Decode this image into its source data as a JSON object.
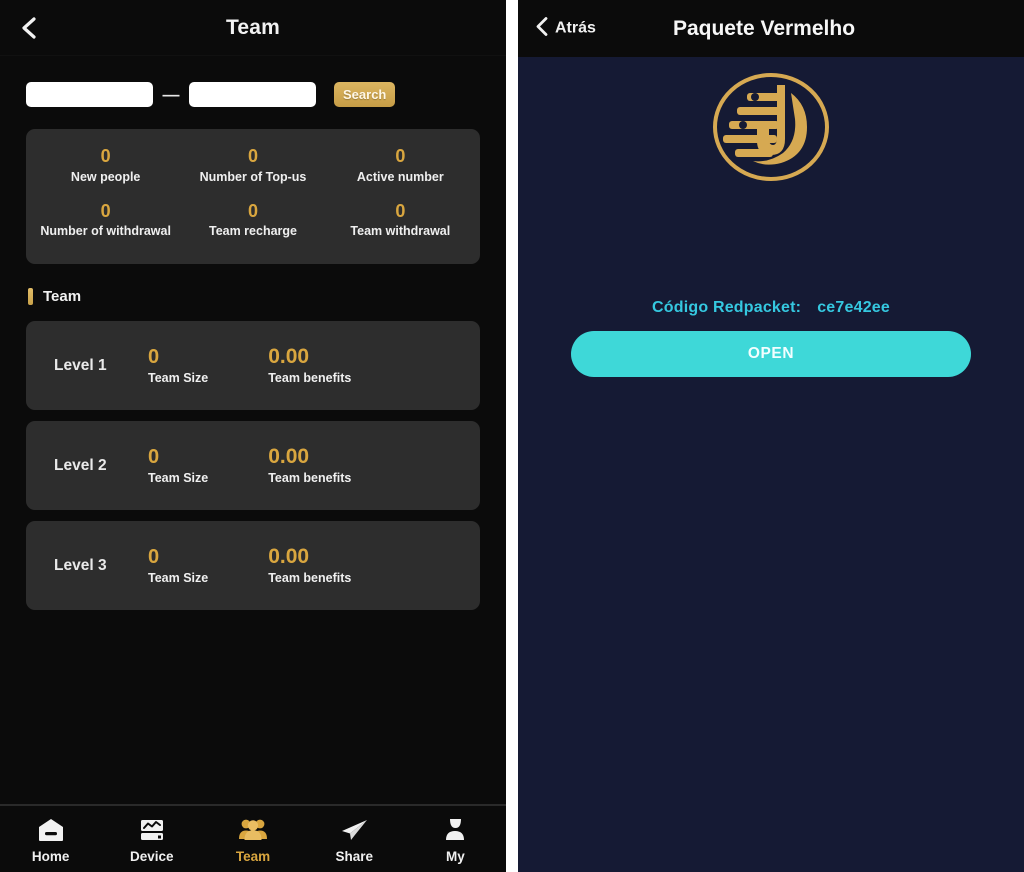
{
  "left": {
    "header": {
      "back_icon": "chevron-left-icon",
      "title": "Team"
    },
    "search": {
      "from_value": "",
      "from_placeholder": "",
      "separator": "—",
      "to_value": "",
      "to_placeholder": "",
      "button_label": "Search"
    },
    "stats": [
      {
        "value": "0",
        "label": "New people"
      },
      {
        "value": "0",
        "label": "Number of Top-us"
      },
      {
        "value": "0",
        "label": "Active number"
      },
      {
        "value": "0",
        "label": "Number of withdrawal"
      },
      {
        "value": "0",
        "label": "Team recharge"
      },
      {
        "value": "0",
        "label": "Team withdrawal"
      }
    ],
    "section": {
      "title": "Team"
    },
    "levels": [
      {
        "name": "Level 1",
        "size_value": "0",
        "size_label": "Team Size",
        "benefit_value": "0.00",
        "benefit_label": "Team benefits"
      },
      {
        "name": "Level 2",
        "size_value": "0",
        "size_label": "Team Size",
        "benefit_value": "0.00",
        "benefit_label": "Team benefits"
      },
      {
        "name": "Level 3",
        "size_value": "0",
        "size_label": "Team Size",
        "benefit_value": "0.00",
        "benefit_label": "Team benefits"
      }
    ],
    "tabbar": [
      {
        "icon": "home-icon",
        "label": "Home",
        "active": false
      },
      {
        "icon": "device-chart-icon",
        "label": "Device",
        "active": false
      },
      {
        "icon": "team-people-icon",
        "label": "Team",
        "active": true
      },
      {
        "icon": "share-paper-plane-icon",
        "label": "Share",
        "active": false
      },
      {
        "icon": "user-profile-icon",
        "label": "My",
        "active": false
      }
    ]
  },
  "right": {
    "header": {
      "back_icon": "chevron-left-icon",
      "back_label": "Atrás",
      "title": "Paquete Vermelho"
    },
    "logo": {
      "icon": "brand-u-circle-logo",
      "color": "#d6a952"
    },
    "code": {
      "label": "Código Redpacket:",
      "value": "ce7e42ee"
    },
    "open_button": {
      "label": "OPEN"
    }
  },
  "colors": {
    "gold": "#d9a63f",
    "cyan": "#35c8e0",
    "turquoise": "#3ed8d8",
    "card_bg": "#2d2d2d",
    "left_bg": "#0b0b0b",
    "right_bg": "#151a34"
  }
}
